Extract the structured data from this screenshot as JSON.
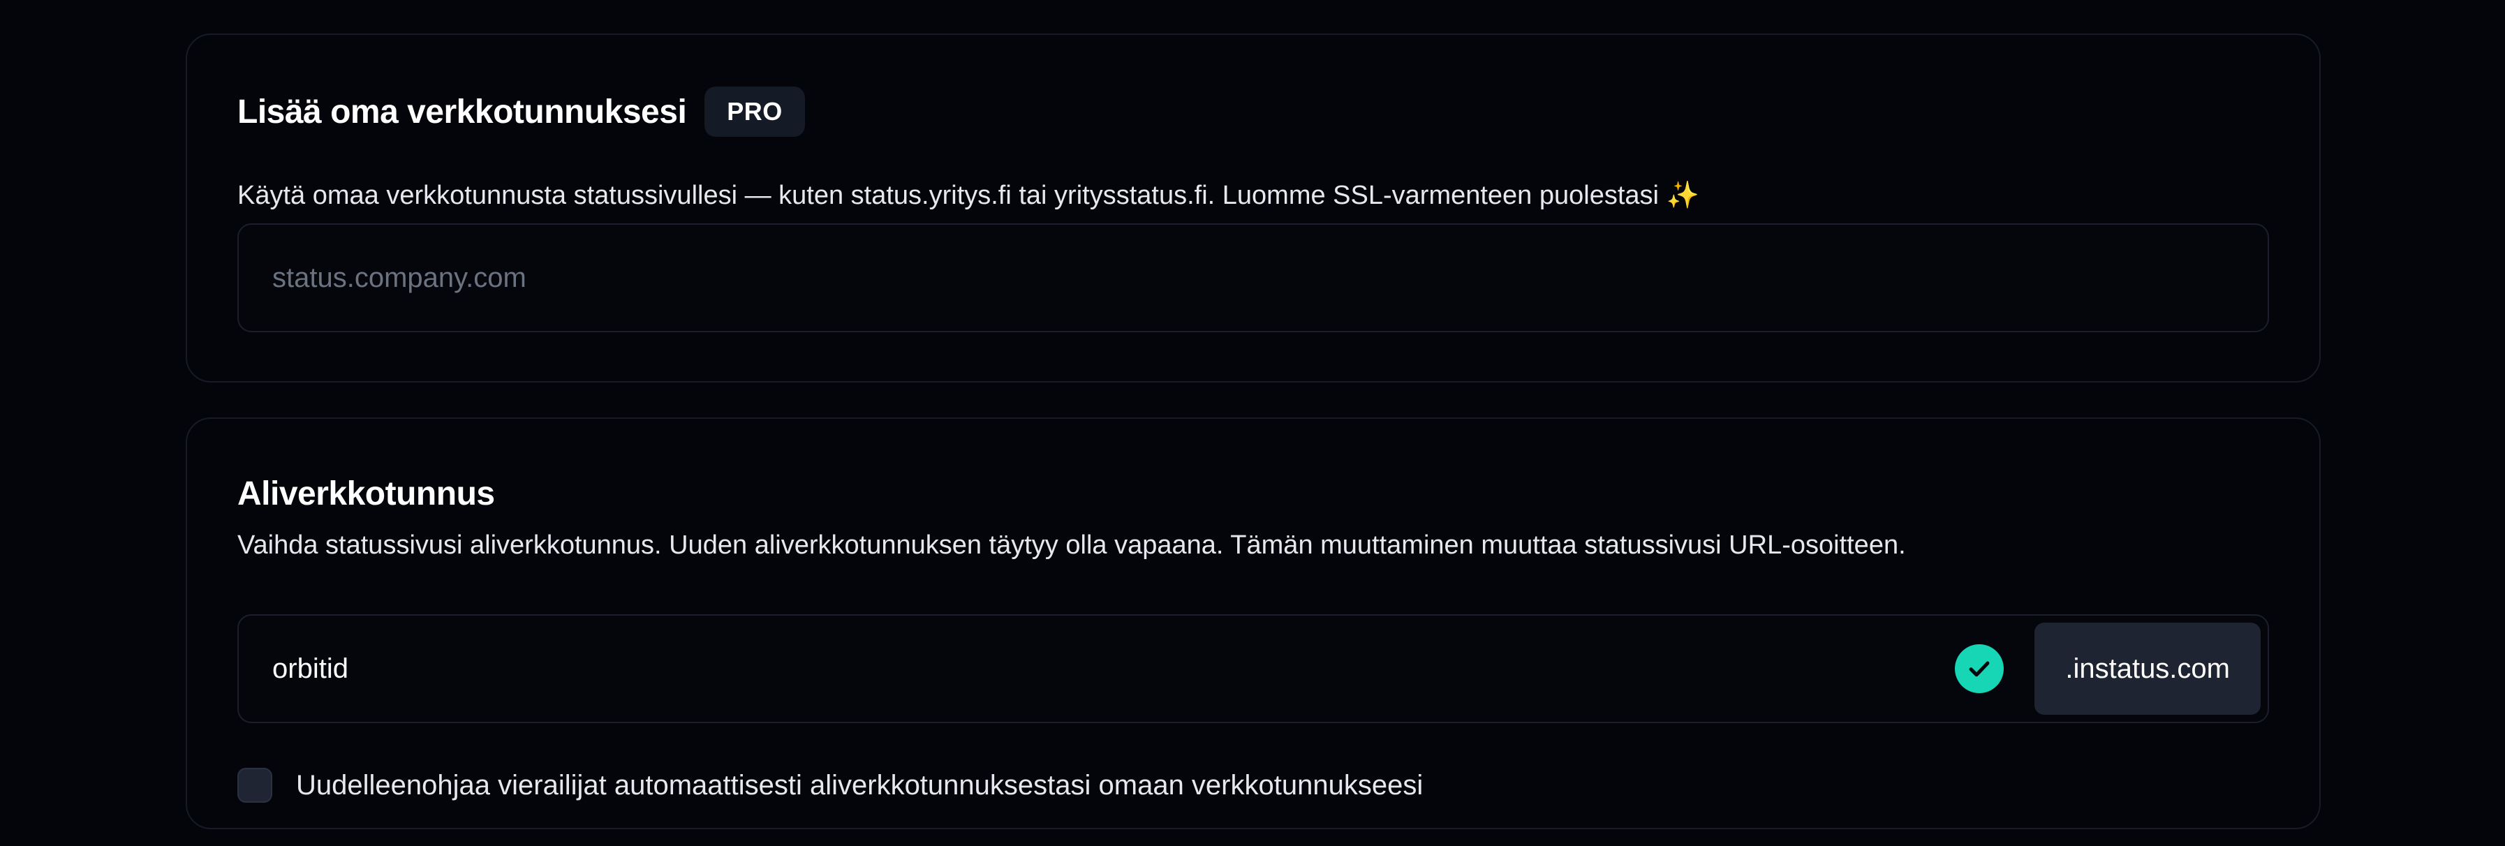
{
  "custom_domain": {
    "title": "Lisää oma verkkotunnuksesi",
    "badge": "PRO",
    "description": "Käytä omaa verkkotunnusta statussivullesi — kuten status.yritys.fi tai yritysstatus.fi. Luomme SSL-varmenteen puolestasi ✨",
    "input": {
      "value": "",
      "placeholder": "status.company.com"
    }
  },
  "subdomain": {
    "title": "Aliverkkotunnus",
    "description": "Vaihda statussivusi aliverkkotunnus. Uuden aliverkkotunnuksen täytyy olla vapaana. Tämän muuttaminen muuttaa statussivusi URL-osoitteen.",
    "input": {
      "value": "orbitid",
      "status_icon": "check-circle-icon",
      "suffix": ".instatus.com"
    },
    "redirect_checkbox": {
      "checked": false,
      "label": "Uudelleenohjaa vierailijat automaattisesti aliverkkotunnuksestasi omaan verkkotunnukseesi"
    }
  },
  "colors": {
    "background": "#03050b",
    "card_border": "#161b26",
    "success": "#17d6b5",
    "badge_bg": "#151a27",
    "suffix_bg": "#1e2431"
  }
}
